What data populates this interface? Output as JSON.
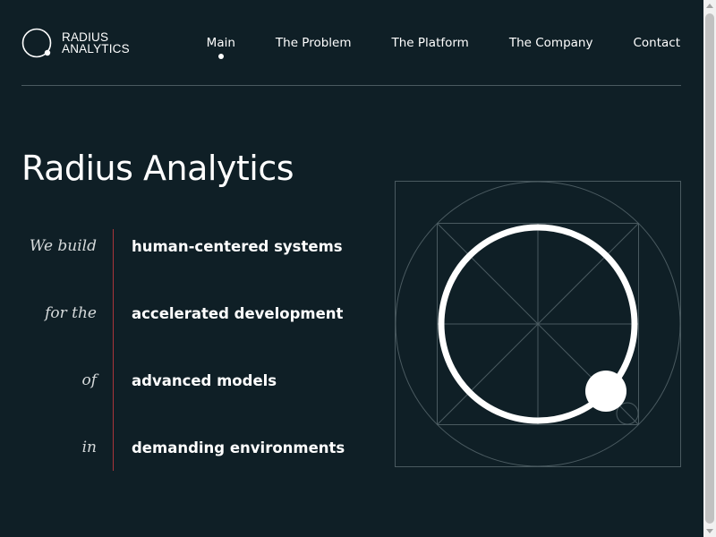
{
  "brand": {
    "line1": "RADIUS",
    "line2": "ANALYTICS",
    "logo_icon": "ring-logo-icon"
  },
  "nav": {
    "items": [
      {
        "label": "Main",
        "active": true
      },
      {
        "label": "The Problem",
        "active": false
      },
      {
        "label": "The Platform",
        "active": false
      },
      {
        "label": "The Company",
        "active": false
      },
      {
        "label": "Contact",
        "active": false
      }
    ]
  },
  "hero": {
    "title": "Radius Analytics",
    "rows": [
      {
        "lead": "We build",
        "main": "human-centered systems"
      },
      {
        "lead": "for the",
        "main": "accelerated development"
      },
      {
        "lead": "of",
        "main": "advanced models"
      },
      {
        "lead": "in",
        "main": "demanding environments"
      }
    ]
  },
  "colors": {
    "background": "#0f1f26",
    "accent_divider": "#a8343a",
    "text": "#ffffff",
    "grid_lines": "#4a5a60"
  }
}
